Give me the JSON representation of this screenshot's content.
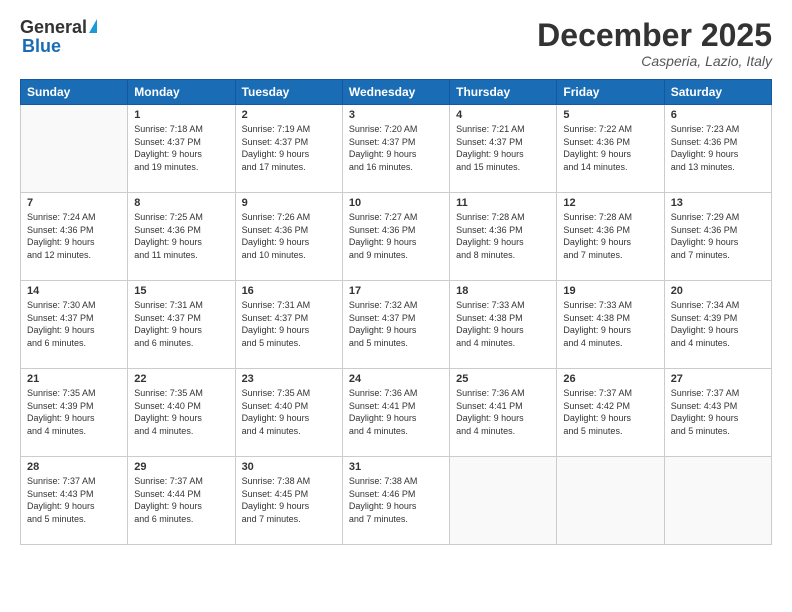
{
  "header": {
    "logo_general": "General",
    "logo_blue": "Blue",
    "month_title": "December 2025",
    "location": "Casperia, Lazio, Italy"
  },
  "days_of_week": [
    "Sunday",
    "Monday",
    "Tuesday",
    "Wednesday",
    "Thursday",
    "Friday",
    "Saturday"
  ],
  "weeks": [
    [
      {
        "day": "",
        "info": ""
      },
      {
        "day": "1",
        "info": "Sunrise: 7:18 AM\nSunset: 4:37 PM\nDaylight: 9 hours\nand 19 minutes."
      },
      {
        "day": "2",
        "info": "Sunrise: 7:19 AM\nSunset: 4:37 PM\nDaylight: 9 hours\nand 17 minutes."
      },
      {
        "day": "3",
        "info": "Sunrise: 7:20 AM\nSunset: 4:37 PM\nDaylight: 9 hours\nand 16 minutes."
      },
      {
        "day": "4",
        "info": "Sunrise: 7:21 AM\nSunset: 4:37 PM\nDaylight: 9 hours\nand 15 minutes."
      },
      {
        "day": "5",
        "info": "Sunrise: 7:22 AM\nSunset: 4:36 PM\nDaylight: 9 hours\nand 14 minutes."
      },
      {
        "day": "6",
        "info": "Sunrise: 7:23 AM\nSunset: 4:36 PM\nDaylight: 9 hours\nand 13 minutes."
      }
    ],
    [
      {
        "day": "7",
        "info": "Sunrise: 7:24 AM\nSunset: 4:36 PM\nDaylight: 9 hours\nand 12 minutes."
      },
      {
        "day": "8",
        "info": "Sunrise: 7:25 AM\nSunset: 4:36 PM\nDaylight: 9 hours\nand 11 minutes."
      },
      {
        "day": "9",
        "info": "Sunrise: 7:26 AM\nSunset: 4:36 PM\nDaylight: 9 hours\nand 10 minutes."
      },
      {
        "day": "10",
        "info": "Sunrise: 7:27 AM\nSunset: 4:36 PM\nDaylight: 9 hours\nand 9 minutes."
      },
      {
        "day": "11",
        "info": "Sunrise: 7:28 AM\nSunset: 4:36 PM\nDaylight: 9 hours\nand 8 minutes."
      },
      {
        "day": "12",
        "info": "Sunrise: 7:28 AM\nSunset: 4:36 PM\nDaylight: 9 hours\nand 7 minutes."
      },
      {
        "day": "13",
        "info": "Sunrise: 7:29 AM\nSunset: 4:36 PM\nDaylight: 9 hours\nand 7 minutes."
      }
    ],
    [
      {
        "day": "14",
        "info": "Sunrise: 7:30 AM\nSunset: 4:37 PM\nDaylight: 9 hours\nand 6 minutes."
      },
      {
        "day": "15",
        "info": "Sunrise: 7:31 AM\nSunset: 4:37 PM\nDaylight: 9 hours\nand 6 minutes."
      },
      {
        "day": "16",
        "info": "Sunrise: 7:31 AM\nSunset: 4:37 PM\nDaylight: 9 hours\nand 5 minutes."
      },
      {
        "day": "17",
        "info": "Sunrise: 7:32 AM\nSunset: 4:37 PM\nDaylight: 9 hours\nand 5 minutes."
      },
      {
        "day": "18",
        "info": "Sunrise: 7:33 AM\nSunset: 4:38 PM\nDaylight: 9 hours\nand 4 minutes."
      },
      {
        "day": "19",
        "info": "Sunrise: 7:33 AM\nSunset: 4:38 PM\nDaylight: 9 hours\nand 4 minutes."
      },
      {
        "day": "20",
        "info": "Sunrise: 7:34 AM\nSunset: 4:39 PM\nDaylight: 9 hours\nand 4 minutes."
      }
    ],
    [
      {
        "day": "21",
        "info": "Sunrise: 7:35 AM\nSunset: 4:39 PM\nDaylight: 9 hours\nand 4 minutes."
      },
      {
        "day": "22",
        "info": "Sunrise: 7:35 AM\nSunset: 4:40 PM\nDaylight: 9 hours\nand 4 minutes."
      },
      {
        "day": "23",
        "info": "Sunrise: 7:35 AM\nSunset: 4:40 PM\nDaylight: 9 hours\nand 4 minutes."
      },
      {
        "day": "24",
        "info": "Sunrise: 7:36 AM\nSunset: 4:41 PM\nDaylight: 9 hours\nand 4 minutes."
      },
      {
        "day": "25",
        "info": "Sunrise: 7:36 AM\nSunset: 4:41 PM\nDaylight: 9 hours\nand 4 minutes."
      },
      {
        "day": "26",
        "info": "Sunrise: 7:37 AM\nSunset: 4:42 PM\nDaylight: 9 hours\nand 5 minutes."
      },
      {
        "day": "27",
        "info": "Sunrise: 7:37 AM\nSunset: 4:43 PM\nDaylight: 9 hours\nand 5 minutes."
      }
    ],
    [
      {
        "day": "28",
        "info": "Sunrise: 7:37 AM\nSunset: 4:43 PM\nDaylight: 9 hours\nand 5 minutes."
      },
      {
        "day": "29",
        "info": "Sunrise: 7:37 AM\nSunset: 4:44 PM\nDaylight: 9 hours\nand 6 minutes."
      },
      {
        "day": "30",
        "info": "Sunrise: 7:38 AM\nSunset: 4:45 PM\nDaylight: 9 hours\nand 7 minutes."
      },
      {
        "day": "31",
        "info": "Sunrise: 7:38 AM\nSunset: 4:46 PM\nDaylight: 9 hours\nand 7 minutes."
      },
      {
        "day": "",
        "info": ""
      },
      {
        "day": "",
        "info": ""
      },
      {
        "day": "",
        "info": ""
      }
    ]
  ]
}
